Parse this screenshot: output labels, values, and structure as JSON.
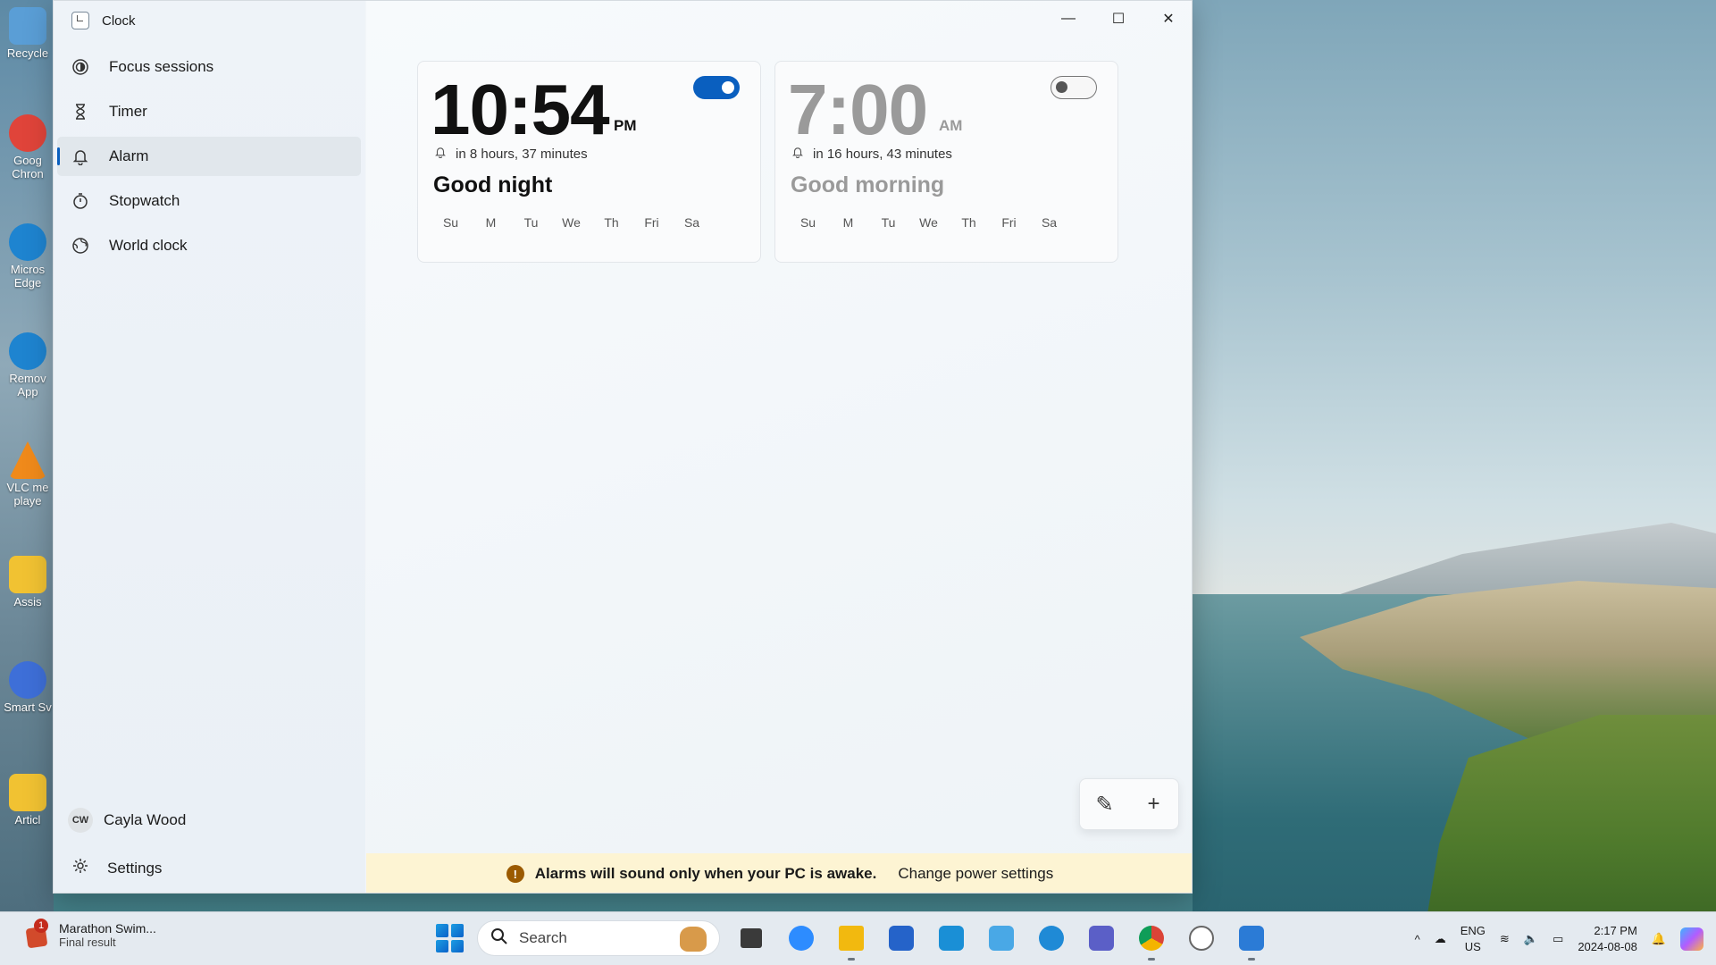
{
  "desktop": {
    "icons": [
      {
        "label": "Recycle",
        "color": "#5a9ed6"
      },
      {
        "label": "Goog Chron",
        "color": "#e0443a"
      },
      {
        "label": "Micros Edge",
        "color": "#1e84d0"
      },
      {
        "label": "Remov App",
        "color": "#1e84d0"
      },
      {
        "label": "VLC me playe",
        "color": "#f08a1b"
      },
      {
        "label": "Assis",
        "color": "#f1c232"
      },
      {
        "label": "Smart Sv",
        "color": "#3e6fd8"
      },
      {
        "label": "Articl",
        "color": "#f1c232"
      }
    ]
  },
  "window": {
    "title": "Clock",
    "controls": {
      "minimize": "—",
      "maximize": "☐",
      "close": "✕"
    }
  },
  "sidebar": {
    "items": [
      {
        "label": "Focus sessions",
        "icon": "focus-icon"
      },
      {
        "label": "Timer",
        "icon": "hourglass-icon"
      },
      {
        "label": "Alarm",
        "icon": "bell-icon",
        "active": true
      },
      {
        "label": "Stopwatch",
        "icon": "stopwatch-icon"
      },
      {
        "label": "World clock",
        "icon": "globe-icon"
      }
    ],
    "user": {
      "initials": "CW",
      "name": "Cayla Wood"
    },
    "settings_label": "Settings"
  },
  "alarms": [
    {
      "time": "10:54",
      "period": "PM",
      "due": "in 8 hours, 37 minutes",
      "name": "Good night",
      "enabled": true,
      "days": [
        "Su",
        "M",
        "Tu",
        "We",
        "Th",
        "Fri",
        "Sa"
      ]
    },
    {
      "time": "7:00",
      "period": "AM",
      "due": "in 16 hours, 43 minutes",
      "name": "Good morning",
      "enabled": false,
      "days": [
        "Su",
        "M",
        "Tu",
        "We",
        "Th",
        "Fri",
        "Sa"
      ]
    }
  ],
  "actions": {
    "edit_icon": "✎",
    "add_icon": "+"
  },
  "banner": {
    "message": "Alarms will sound only when your PC is awake.",
    "link": "Change power settings"
  },
  "taskbar": {
    "notification": {
      "badge": "1",
      "title": "Marathon Swim...",
      "subtitle": "Final result"
    },
    "search_placeholder": "Search",
    "apps": [
      {
        "name": "task-view",
        "color": "#3a3a3a"
      },
      {
        "name": "zoom",
        "color": "#2d8cff"
      },
      {
        "name": "file-explorer",
        "color": "#f2b90f"
      },
      {
        "name": "store",
        "color": "#2563c9"
      },
      {
        "name": "news",
        "color": "#1a8fd6"
      },
      {
        "name": "photos",
        "color": "#49a8e6"
      },
      {
        "name": "edge",
        "color": "#1f8ad6"
      },
      {
        "name": "teams",
        "color": "#5b5fc7"
      },
      {
        "name": "chrome",
        "color": "#db4437"
      },
      {
        "name": "clock",
        "color": "#ffffff"
      },
      {
        "name": "paint",
        "color": "#2b7bd6"
      }
    ],
    "tray": {
      "lang1": "ENG",
      "lang2": "US",
      "time": "2:17 PM",
      "date": "2024-08-08"
    }
  }
}
